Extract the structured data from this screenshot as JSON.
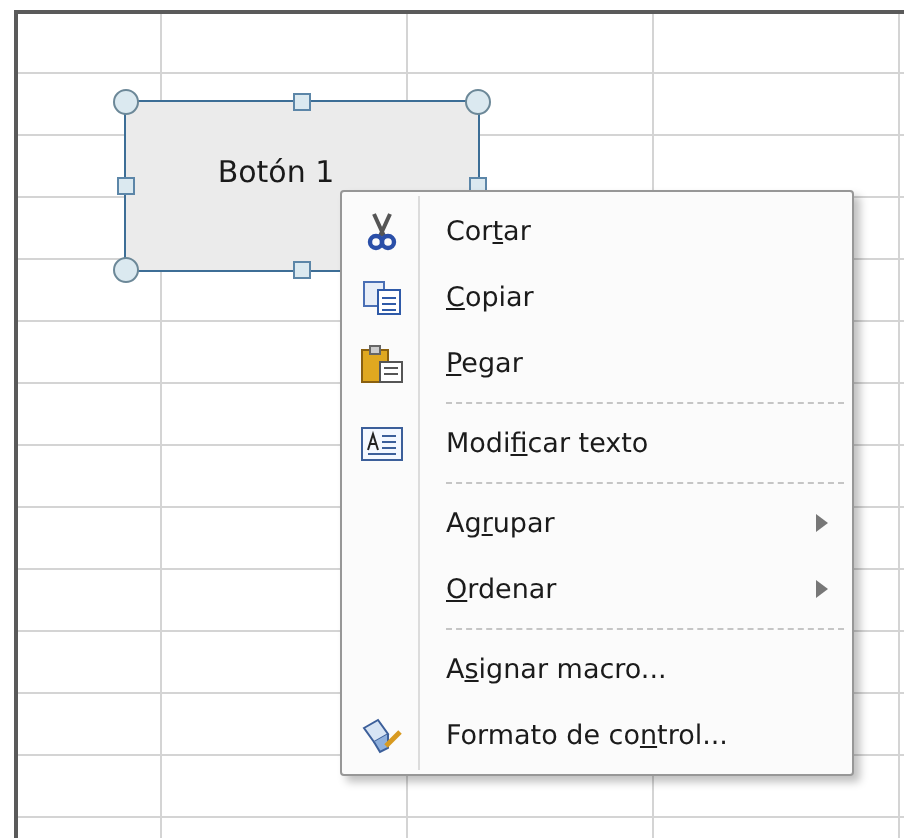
{
  "form_button": {
    "label": "Botón 1",
    "selected": true
  },
  "context_menu": {
    "items": [
      {
        "kind": "cut",
        "before": "Cor",
        "access_key": "t",
        "after": "ar",
        "separator_before": false,
        "submenu": false
      },
      {
        "kind": "copy",
        "access_key": "C",
        "after": "opiar",
        "separator_before": false,
        "submenu": false
      },
      {
        "kind": "paste",
        "access_key": "P",
        "after": "egar",
        "separator_before": false,
        "submenu": false
      },
      {
        "kind": "edittext",
        "before": "Modi",
        "access_key": "f",
        "after": "icar texto",
        "separator_before": true,
        "submenu": false
      },
      {
        "kind": "plain",
        "before": "Ag",
        "access_key": "r",
        "after": "upar",
        "separator_before": true,
        "submenu": true
      },
      {
        "kind": "plain",
        "access_key": "O",
        "after": "rdenar",
        "separator_before": false,
        "submenu": true
      },
      {
        "kind": "plain",
        "before": "A",
        "access_key": "s",
        "after": "ignar macro...",
        "separator_before": true,
        "submenu": false
      },
      {
        "kind": "format",
        "before": "Formato de co",
        "access_key": "n",
        "after": "trol...",
        "separator_before": false,
        "submenu": false
      }
    ]
  }
}
